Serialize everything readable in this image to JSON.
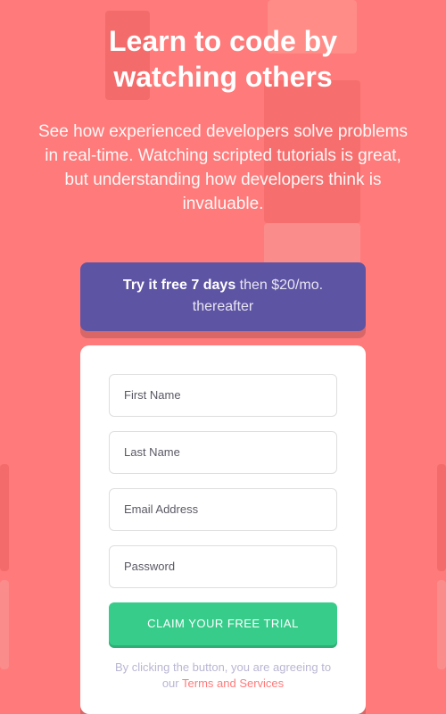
{
  "headline": {
    "line1": "Learn to code by",
    "line2": "watching others"
  },
  "subtext": "See how experienced developers solve problems in real-time. Watching scripted tutorials is great, but understanding how developers think is invaluable.",
  "promo": {
    "strong": "Try it free 7 days",
    "light": "then $20/mo. thereafter"
  },
  "form": {
    "first_name_placeholder": "First Name",
    "last_name_placeholder": "Last Name",
    "email_placeholder": "Email Address",
    "password_placeholder": "Password",
    "submit_label": "CLAIM YOUR FREE TRIAL",
    "terms_prefix": "By clicking the button, you are agreeing to our",
    "terms_link": "Terms and Services"
  },
  "colors": {
    "background": "#ff7a7a",
    "promo": "#5e54a4",
    "submit": "#38cc8b",
    "link": "#ff7a7a"
  }
}
